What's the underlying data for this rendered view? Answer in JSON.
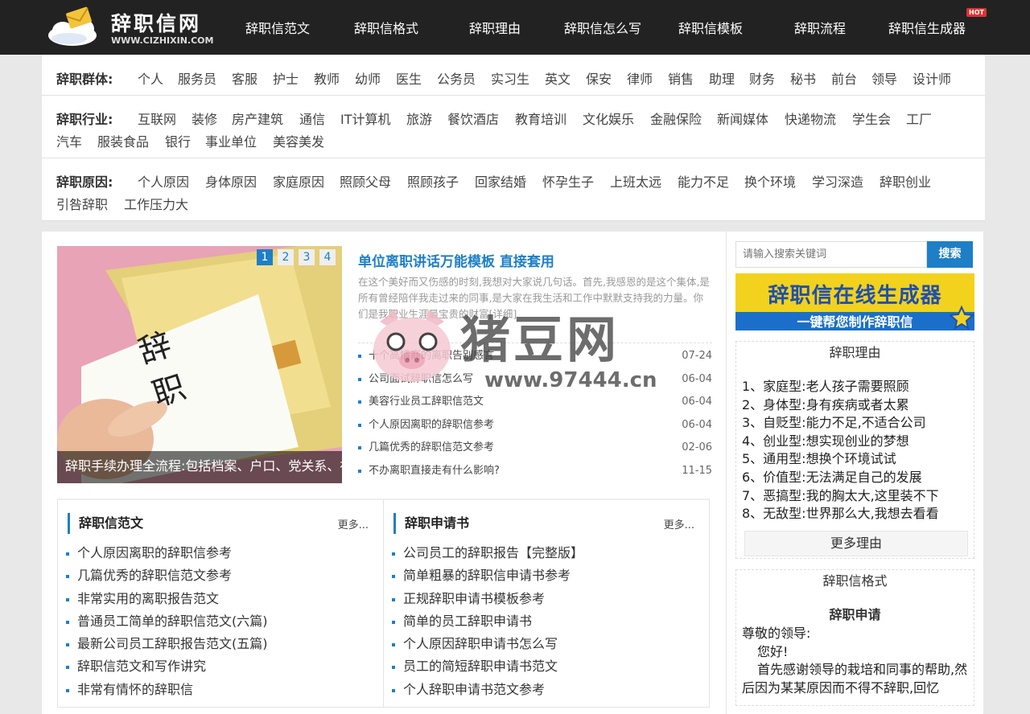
{
  "logo": {
    "name": "辞职信网",
    "domain": "WWW.CIZHIXIN.COM"
  },
  "nav": [
    "辞职信范文",
    "辞职信格式",
    "辞职理由",
    "辞职信怎么写",
    "辞职信模板",
    "辞职流程",
    "辞职信生成器"
  ],
  "nav_hot_badge": "HOT",
  "categories": {
    "group": {
      "label": "辞职群体:",
      "tags": [
        "个人",
        "服务员",
        "客服",
        "护士",
        "教师",
        "幼师",
        "医生",
        "公务员",
        "实习生",
        "英文",
        "保安",
        "律师",
        "销售",
        "助理",
        "财务",
        "秘书",
        "前台",
        "领导",
        "设计师"
      ]
    },
    "industry": {
      "label": "辞职行业:",
      "tags_line1": [
        "互联网",
        "装修",
        "房产建筑",
        "通信",
        "IT计算机",
        "旅游",
        "餐饮酒店",
        "教育培训",
        "文化娱乐",
        "金融保险",
        "新闻媒体",
        "快递物流",
        "学生会",
        "工厂"
      ],
      "tags_line2": [
        "汽车",
        "服装食品",
        "银行",
        "事业单位",
        "美容美发"
      ]
    },
    "reason": {
      "label": "辞职原因:",
      "tags_line1": [
        "个人原因",
        "身体原因",
        "家庭原因",
        "照顾父母",
        "照顾孩子",
        "回家结婚",
        "怀孕生子",
        "上班太远",
        "能力不足",
        "换个环境",
        "学习深造",
        "辞职创业"
      ],
      "tags_line2": [
        "引咎辞职",
        "工作压力大"
      ]
    }
  },
  "slider": {
    "caption": "辞职手续办理全流程:包括档案、户口、党关系、社保转移、公积金等",
    "pages": [
      "1",
      "2",
      "3",
      "4"
    ],
    "image_text": "辞 职"
  },
  "headline": {
    "title": "单位离职讲话万能模板 直接套用",
    "summary": "在这个美好而又伤感的时刻,我想对大家说几句话。首先,我感恩的是这个集体,是所有曾经陪伴我走过来的同事,是大家在我生活和工作中默默支持我的力量。你们是我职业生涯最宝贵的财富[详细]"
  },
  "news": [
    {
      "title": "十个高情商的离职告别感言",
      "date": "07-24"
    },
    {
      "title": "公司面试辞职信怎么写",
      "date": "06-04"
    },
    {
      "title": "美容行业员工辞职信范文",
      "date": "06-04"
    },
    {
      "title": "个人原因离职的辞职信参考",
      "date": "06-04"
    },
    {
      "title": "几篇优秀的辞职信范文参考",
      "date": "02-06"
    },
    {
      "title": "不办离职直接走有什么影响?",
      "date": "11-15"
    }
  ],
  "box_left": {
    "title": "辞职信范文",
    "more": "更多...",
    "items": [
      "个人原因离职的辞职信参考",
      "几篇优秀的辞职信范文参考",
      "非常实用的离职报告范文",
      "普通员工简单的辞职信范文(六篇)",
      "最新公司员工辞职报告范文(五篇)",
      "辞职信范文和写作讲究",
      "非常有情怀的辞职信"
    ]
  },
  "box_right": {
    "title": "辞职申请书",
    "more": "更多...",
    "items": [
      "公司员工的辞职报告【完整版】",
      "简单粗暴的辞职信申请书参考",
      "正规辞职申请书模板参考",
      "简单的员工辞职申请书",
      "个人原因辞职申请书怎么写",
      "员工的简短辞职申请书范文",
      "个人辞职申请书范文参考"
    ]
  },
  "sidebar": {
    "search_placeholder": "请输入搜索关键词",
    "search_button": "搜索",
    "banner_title": "辞职信在线生成器",
    "banner_sub": "一键帮您制作辞职信",
    "reasons_title": "辞职理由",
    "reasons": [
      "1、家庭型:老人孩子需要照顾",
      "2、身体型:身有疾病或者太累",
      "3、自贬型:能力不足,不适合公司",
      "4、创业型:想实现创业的梦想",
      "5、通用型:想换个环境试试",
      "6、价值型:无法满足自己的发展",
      "7、恶搞型:我的胸太大,这里装不下",
      "8、无敌型:世界那么大,我想去看看"
    ],
    "reasons_more": "更多理由",
    "format_title": "辞职信格式",
    "letter_heading": "辞职申请",
    "letter_greeting": "尊敬的领导:",
    "letter_hello": "您好!",
    "letter_body": "首先感谢领导的栽培和同事的帮助,然后因为某某原因而不得不辞职,回忆"
  },
  "watermark": {
    "text": "猪豆网",
    "url": "www.97444.cn"
  }
}
